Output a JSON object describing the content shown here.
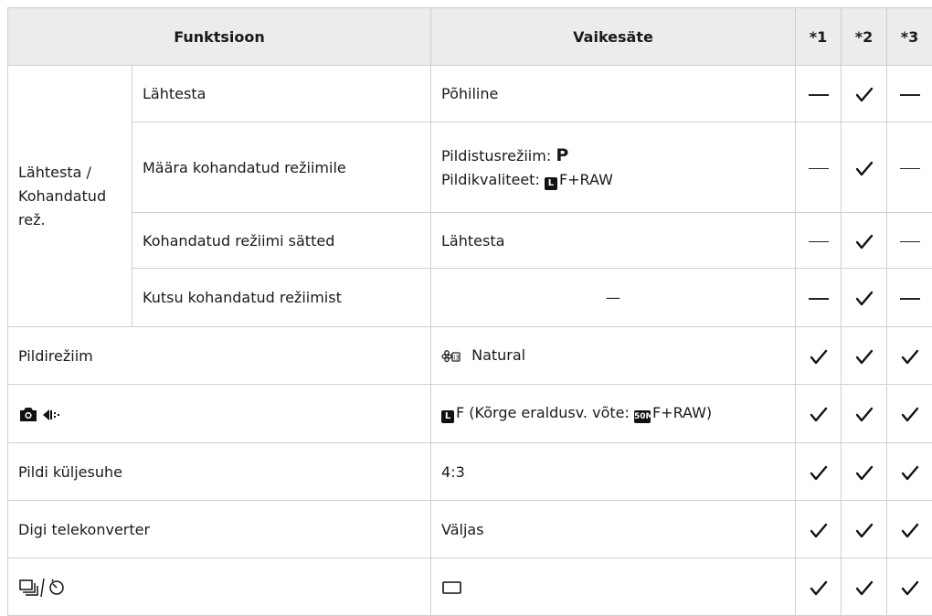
{
  "header": {
    "function": "Funktsioon",
    "default": "Vaikesäte",
    "c1": "*1",
    "c2": "*2",
    "c3": "*3"
  },
  "group": {
    "label_lines": [
      "Lähtesta /",
      "Kohandatud",
      "rež."
    ]
  },
  "rows": [
    {
      "sub": "Lähtesta",
      "value": "Põhiline",
      "marks": [
        "dash",
        "check",
        "dash"
      ]
    },
    {
      "sub": "Määra kohandatud režiimile",
      "value_line1_label": "Pildistusrežiim:",
      "value_line1_symbol": "P",
      "value_line2_label": "Pildikvaliteet:",
      "value_line2_badge": "L",
      "value_line2_suffix": "F+RAW",
      "marks": [
        "dash",
        "check",
        "dash"
      ]
    },
    {
      "sub": "Kohandatud režiimi sätted",
      "value": "Lähtesta",
      "marks": [
        "dash",
        "check",
        "dash"
      ]
    },
    {
      "sub": "Kutsu kohandatud režiimist",
      "value": "—",
      "marks": [
        "dash",
        "check",
        "dash"
      ]
    },
    {
      "function": "Pildirežiim",
      "value_icon": "picture-mode-natural-icon",
      "value": "Natural",
      "marks": [
        "check",
        "check",
        "check"
      ]
    },
    {
      "function_icon": "camera-quality-icon",
      "value_badge": "L",
      "value_text1": "F (Kõrge eraldusv. võte: ",
      "value_badge2": "50M",
      "value_text2": "F+RAW)",
      "marks": [
        "check",
        "check",
        "check"
      ]
    },
    {
      "function": "Pildi küljesuhe",
      "value": "4:3",
      "marks": [
        "check",
        "check",
        "check"
      ]
    },
    {
      "function": "Digi telekonverter",
      "value": "Väljas",
      "marks": [
        "check",
        "check",
        "check"
      ]
    },
    {
      "function_icon": "sequential-self-timer-icon",
      "value_icon": "single-frame-icon",
      "marks": [
        "check",
        "check",
        "check"
      ]
    }
  ]
}
